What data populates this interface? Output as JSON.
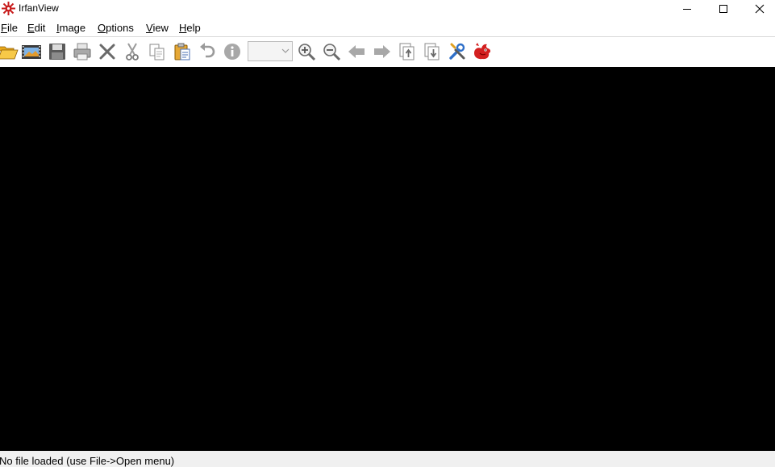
{
  "window": {
    "title": "IrfanView"
  },
  "menu": [
    {
      "accel": "F",
      "rest": "ile"
    },
    {
      "accel": "E",
      "rest": "dit"
    },
    {
      "accel": "I",
      "rest": "mage"
    },
    {
      "accel": "O",
      "rest": "ptions"
    },
    {
      "accel": "V",
      "rest": "iew"
    },
    {
      "accel": "H",
      "rest": "elp"
    }
  ],
  "toolbar": {
    "icons": [
      "open-folder-icon",
      "slideshow-icon",
      "save-icon",
      "print-icon",
      "delete-icon",
      "cut-icon",
      "copy-icon",
      "paste-icon",
      "undo-icon",
      "info-icon",
      "zoom-in-icon",
      "zoom-out-icon",
      "previous-icon",
      "next-icon",
      "first-page-icon",
      "last-page-icon",
      "properties-icon",
      "irfanview-logo-icon"
    ],
    "zoom_value": ""
  },
  "status": {
    "text": "No file loaded (use File->Open menu)"
  },
  "colors": {
    "canvas": "#000000",
    "accent_red": "#d32020",
    "statusbar": "#f0f0f0"
  }
}
